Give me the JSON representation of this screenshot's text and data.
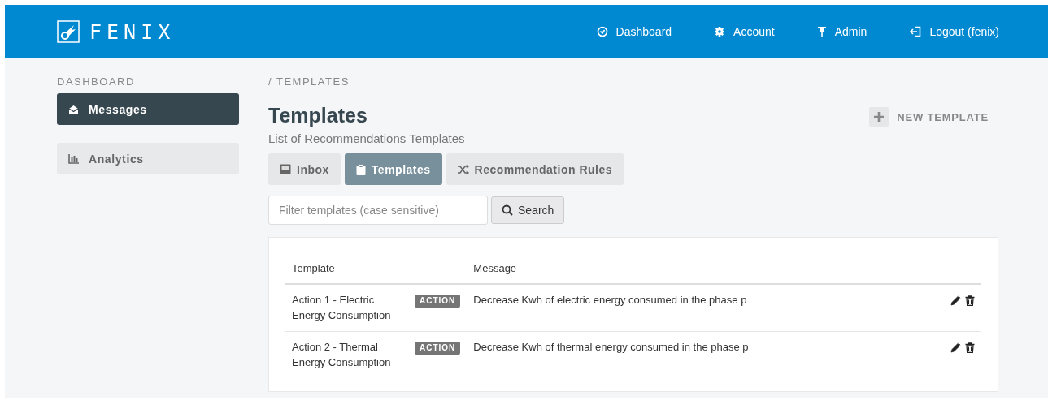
{
  "header": {
    "logo": "FENIX",
    "nav": [
      {
        "kind": "dashboard",
        "label": "Dashboard"
      },
      {
        "kind": "gear",
        "label": "Account"
      },
      {
        "kind": "pin",
        "label": "Admin"
      },
      {
        "kind": "logout",
        "label": "Logout (fenix)"
      }
    ]
  },
  "sidebar": {
    "heading": "DASHBOARD",
    "items": [
      {
        "kind": "envelope",
        "label": "Messages",
        "selected": true
      },
      {
        "kind": "chart",
        "label": "Analytics",
        "selected": false
      }
    ]
  },
  "breadcrumb": "/ TEMPLATES",
  "page": {
    "title": "Templates",
    "subtitle": "List of Recommendations Templates",
    "new_button": "NEW TEMPLATE"
  },
  "tabs": [
    {
      "kind": "inbox",
      "label": "Inbox",
      "selected": false
    },
    {
      "kind": "clipboard",
      "label": "Templates",
      "selected": true
    },
    {
      "kind": "shuffle",
      "label": "Recommendation Rules",
      "selected": false
    }
  ],
  "search": {
    "placeholder": "Filter templates (case sensitive)",
    "button": "Search"
  },
  "table": {
    "columns": [
      "Template",
      "Message"
    ],
    "rows": [
      {
        "template": "Action 1 - Electric Energy Consumption",
        "badge": "ACTION",
        "message": "Decrease Kwh of electric energy consumed in the phase p"
      },
      {
        "template": "Action 2 - Thermal Energy Consumption",
        "badge": "ACTION",
        "message": "Decrease Kwh of thermal energy consumed in the phase p"
      }
    ]
  }
}
